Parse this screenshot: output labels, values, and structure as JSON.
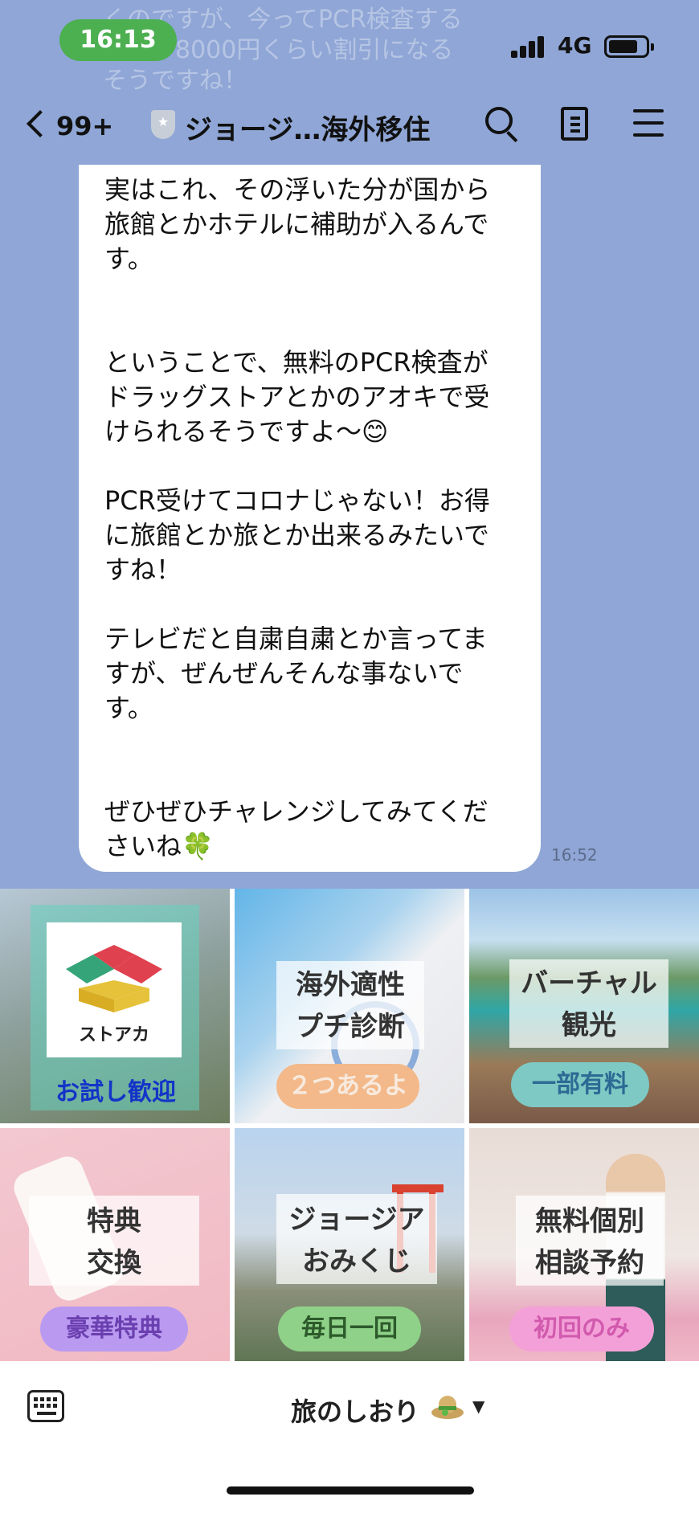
{
  "status_bar": {
    "time": "16:13",
    "network": "4G"
  },
  "ghost_preview": [
    "くのですが、今ってPCR検査する",
    "と何か8000円くらい割引になる",
    "そうですね！"
  ],
  "header": {
    "back_count": "99+",
    "title": "ジョージ…海外移住"
  },
  "message": {
    "lines": [
      "実はこれ、その浮いた分が国から",
      "旅館とかホテルに補助が入るんで",
      "す。",
      "",
      "",
      "ということで、無料のPCR検査が",
      "ドラッグストアとかのアオキで受",
      "けられるそうですよ〜😊",
      "",
      "PCR受けてコロナじゃない！お得",
      "に旅館とか旅とか出来るみたいで",
      "すね！",
      "",
      "テレビだと自粛自粛とか言ってま",
      "すが、ぜんぜんそんな事ないで",
      "す。",
      "",
      "",
      "ぜひぜひチャレンジしてみてくだ",
      "さいね🍀"
    ],
    "time": "16:52"
  },
  "rich_menu": {
    "tiles": [
      {
        "logo_text": "ストアカ",
        "badge": "お試し歓迎"
      },
      {
        "caption_lines": [
          "海外適性",
          "プチ診断"
        ],
        "badge": "２つあるよ"
      },
      {
        "caption_lines": [
          "バーチャル",
          "観光"
        ],
        "badge": "一部有料"
      },
      {
        "caption_lines": [
          "特典",
          "交換"
        ],
        "badge": "豪華特典"
      },
      {
        "caption_lines": [
          "ジョージア",
          "おみくじ"
        ],
        "badge": "毎日一回"
      },
      {
        "caption_lines": [
          "無料個別",
          "相談予約"
        ],
        "badge": "初回のみ"
      }
    ]
  },
  "bottom_bar": {
    "menu_title": "旅のしおり"
  },
  "colors": {
    "chat_background": "#8fa6d6",
    "time_pill": "#4caf50",
    "badge_blue_text": "#1434c8",
    "badge_orange_bg": "#f3b98a",
    "badge_teal_bg": "#7ec9c4",
    "badge_purple_bg": "#b99af0",
    "badge_green_bg": "#8fd188",
    "badge_pink_bg": "#f4a0d8"
  },
  "icons": [
    "chevron-left-icon",
    "shield-star-icon",
    "search-icon",
    "notes-icon",
    "menu-icon",
    "keyboard-icon",
    "hat-icon",
    "caret-down-icon"
  ]
}
